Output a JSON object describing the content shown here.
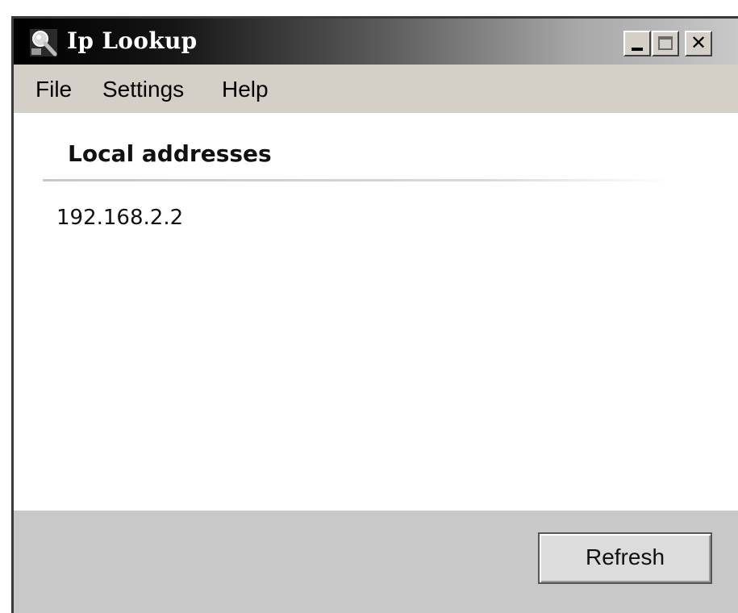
{
  "window": {
    "title": "Ip Lookup",
    "icon": "magnifier-app-icon"
  },
  "title_controls": {
    "minimize": "minimize-icon",
    "maximize": "maximize-icon",
    "close": "close-icon"
  },
  "menubar": {
    "items": [
      {
        "label": "File"
      },
      {
        "label": "Settings"
      },
      {
        "label": "Help"
      }
    ]
  },
  "main": {
    "section_title": "Local addresses",
    "addresses": [
      "192.168.2.2"
    ]
  },
  "footer": {
    "refresh_label": "Refresh"
  },
  "colors": {
    "titlebar_start": "#000000",
    "titlebar_end": "#c8c8c8",
    "window_face": "#d4d0c8",
    "content_bg": "#ffffff",
    "footer_bg": "#c8c8c8"
  }
}
